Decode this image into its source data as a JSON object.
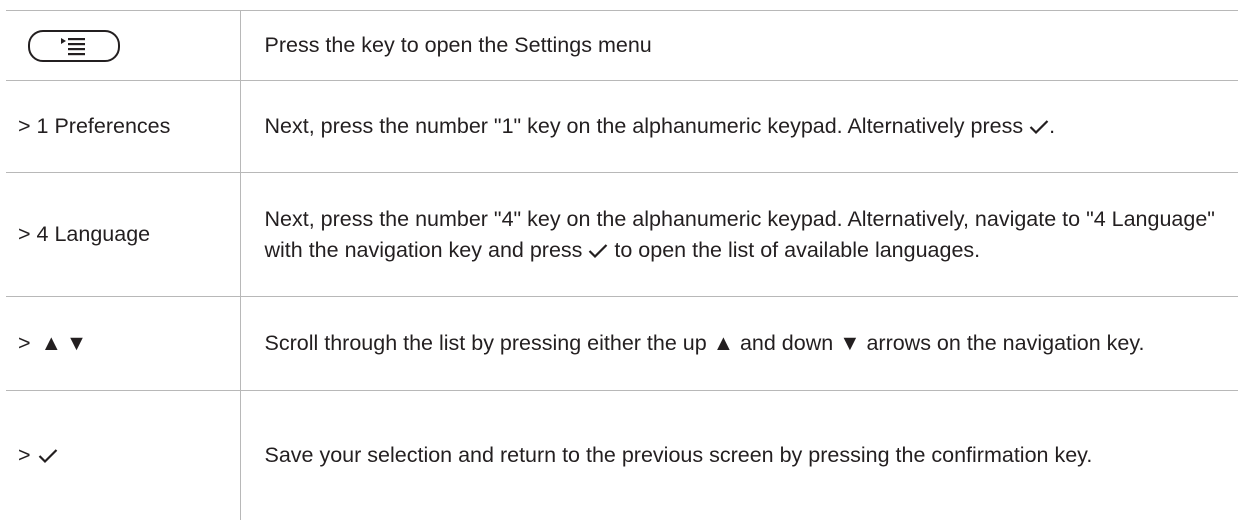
{
  "rows": [
    {
      "step_icon": "menu-key-icon",
      "desc": "Press the key to open the Settings menu"
    },
    {
      "step_label": "> 1 Preferences",
      "desc_part1": "Next, press the number \"1\" key on the alphanumeric keypad.  Alternatively press",
      "desc_part2": "."
    },
    {
      "step_label": "> 4 Language",
      "desc_part1": "Next, press the number \"4\" key on the alphanumeric keypad.  Alternatively, navigate to \"4 Language\" with the navigation key and press",
      "desc_part2": "to open the list of available languages."
    },
    {
      "step_prefix": ">",
      "step_arrows": "▲▼",
      "desc_part1": "Scroll through the list by pressing either the up",
      "up_arrow": "▲",
      "desc_part2": "and down",
      "down_arrow": "▼",
      "desc_part3": "arrows on the navigation key."
    },
    {
      "step_prefix": ">",
      "step_icon": "checkmark-icon",
      "desc": "Save your selection and return to the previous screen by pressing the confirmation key."
    }
  ]
}
